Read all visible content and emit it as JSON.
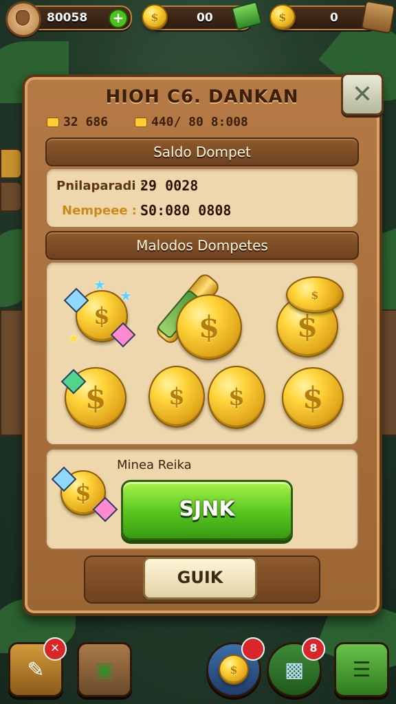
{
  "hud": {
    "xp_value": "80058",
    "coins_value": "00",
    "gold_value": "0"
  },
  "panel": {
    "title": "HIOH C6. DANKAN",
    "stat_left": "32 686",
    "stat_right": "440/ 80 8:008",
    "section_balance": "Saldo Dompet",
    "row1_label": "Pnilaparadi :",
    "row1_value": "29 0028",
    "row2_label": "Nempeee :",
    "row2_value": "S0:080 0808",
    "section_coins": "Malodos Dompetes",
    "bonus_label": "Minea Reika",
    "sync_label": "SJNK",
    "quit_label": "GUIK"
  },
  "bottom_bar": {
    "badge_bag": "8"
  },
  "colors": {
    "panel_wood": "#b57a45",
    "panel_inner": "#eed7ad",
    "sync_green": "#56c51f",
    "coin_gold": "#ffd43a",
    "badge_red": "#d8262a"
  },
  "icons": [
    "avatar-icon",
    "plus-icon",
    "coin-icon",
    "money-stack-icon",
    "treasure-icon",
    "close-icon",
    "quest-icon",
    "map-icon",
    "coin-shop-icon",
    "gift-box-icon",
    "menu-icon"
  ]
}
